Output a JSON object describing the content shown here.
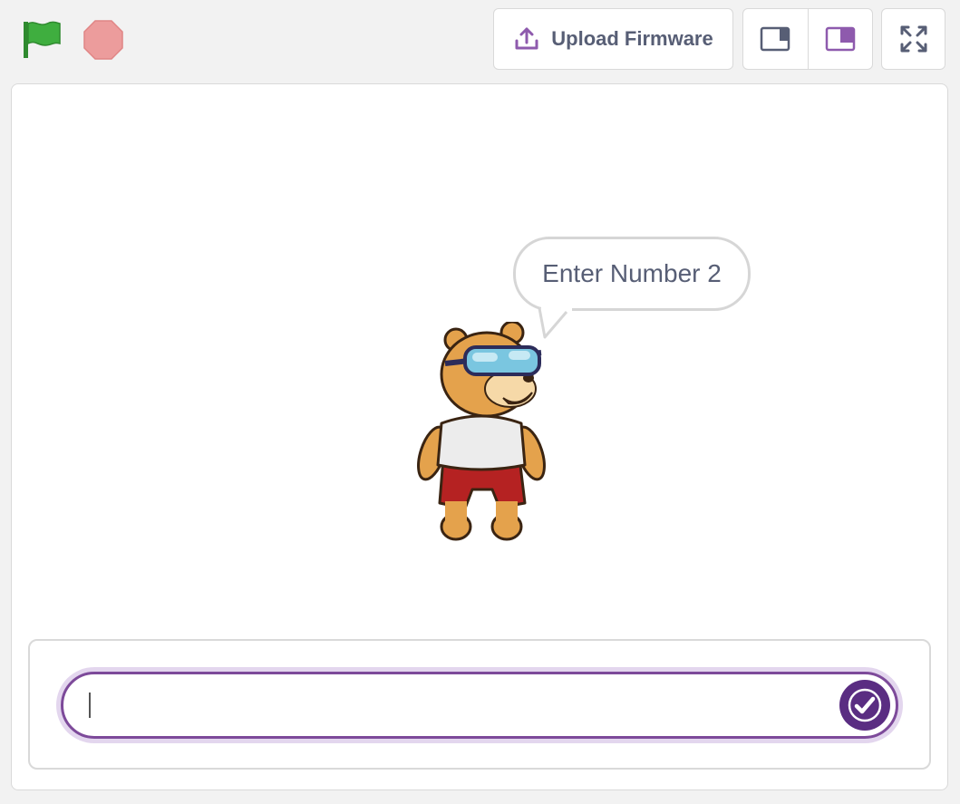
{
  "toolbar": {
    "green_flag_icon": "green-flag-icon",
    "stop_icon": "stop-icon",
    "upload_label": "Upload Firmware",
    "upload_icon": "upload-icon",
    "layout_small_icon": "small-stage-layout-icon",
    "layout_normal_icon": "normal-stage-layout-icon",
    "fullscreen_icon": "fullscreen-icon"
  },
  "stage": {
    "speech_bubble": {
      "text": "Enter Number 2"
    },
    "sprite": "bear-with-goggles"
  },
  "ask_prompt": {
    "input_value": "",
    "submit_icon": "checkmark-icon"
  },
  "colors": {
    "accent": "#7d4a9a",
    "submit": "#5a2d82",
    "flag": "#3fae3f",
    "stop": "#ec9c9c",
    "text": "#575e75"
  }
}
